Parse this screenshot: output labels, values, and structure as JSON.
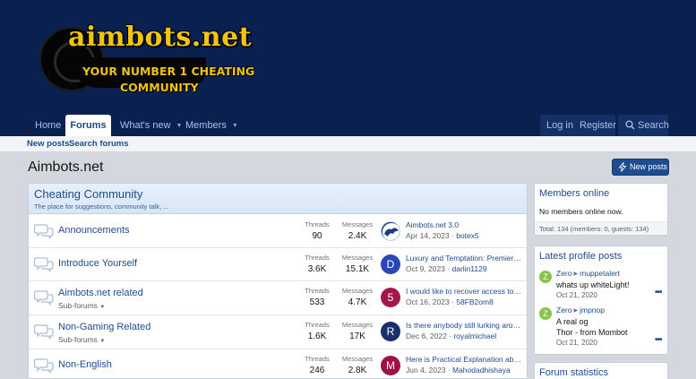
{
  "logo": {
    "title": "aimbots.net",
    "tagline_line1": "YOUR NUMBER 1 CHEATING",
    "tagline_line2": "COMMUNITY"
  },
  "nav": {
    "home": "Home",
    "forums": "Forums",
    "whats_new": "What's new",
    "members": "Members",
    "login": "Log in",
    "register": "Register",
    "search": "Search"
  },
  "subnav": {
    "new_posts": "New posts",
    "search_forums": "Search forums"
  },
  "page": {
    "title": "Aimbots.net",
    "new_posts_button": "New posts"
  },
  "category": {
    "title": "Cheating Community",
    "description": "The place for suggestions, community talk, ...",
    "stat_labels": {
      "threads": "Threads",
      "messages": "Messages"
    },
    "nodes": [
      {
        "title": "Announcements",
        "subforums": "",
        "threads": "90",
        "messages": "2.4K",
        "last_title": "Aimbots.net 3.0",
        "last_date": "Apr 14, 2023",
        "last_user": "botex5",
        "avatar_letter": ""
      },
      {
        "title": "Introduce Yourself",
        "subforums": "",
        "threads": "3.6K",
        "messages": "15.1K",
        "last_title": "Luxury and Temptation: Premier F...",
        "last_date": "Oct 9, 2023",
        "last_user": "darlin1129",
        "avatar_letter": "D"
      },
      {
        "title": "Aimbots.net related",
        "subforums": "Sub-forums",
        "threads": "533",
        "messages": "4.7K",
        "last_title": "I would like to recover access to m...",
        "last_date": "Oct 16, 2023",
        "last_user": "58FB2om8",
        "avatar_letter": "5"
      },
      {
        "title": "Non-Gaming Related",
        "subforums": "Sub-forums",
        "threads": "1.6K",
        "messages": "17K",
        "last_title": "Is there anybody still lurking around?",
        "last_date": "Dec 6, 2022",
        "last_user": "royalmichael",
        "avatar_letter": "R"
      },
      {
        "title": "Non-English",
        "subforums": "",
        "threads": "246",
        "messages": "2.8K",
        "last_title": "Here is Practical Explanation abou...",
        "last_date": "Jun 4, 2023",
        "last_user": "Mahodadhishaya",
        "avatar_letter": "M"
      }
    ]
  },
  "sidebar": {
    "members_online": {
      "title": "Members online",
      "text": "No members online now.",
      "total": "Total: 134 (members: 0, guests: 134)"
    },
    "profile_posts": {
      "title": "Latest profile posts",
      "items": [
        {
          "user": "Zero",
          "target": "muppetalert",
          "message": "whats up whiteLight!",
          "message2": "",
          "date": "Oct 21, 2020",
          "avatar_letter": "Z"
        },
        {
          "user": "Zero",
          "target": "jmpnop",
          "message": "A real og",
          "message2": "Thor - from Mombot",
          "date": "Oct 21, 2020",
          "avatar_letter": "Z"
        }
      ]
    },
    "forum_statistics": {
      "title": "Forum statistics"
    }
  },
  "colors": {
    "header_bg": "#0a2150",
    "accent": "#1d4c8f",
    "logo_gold": "#f1c40f",
    "avatar_d": "#2a47b8",
    "avatar_5": "#a3174b",
    "avatar_r": "#1a2f6b",
    "avatar_m": "#9c1247",
    "profile_avatar": "#8bc34a"
  }
}
